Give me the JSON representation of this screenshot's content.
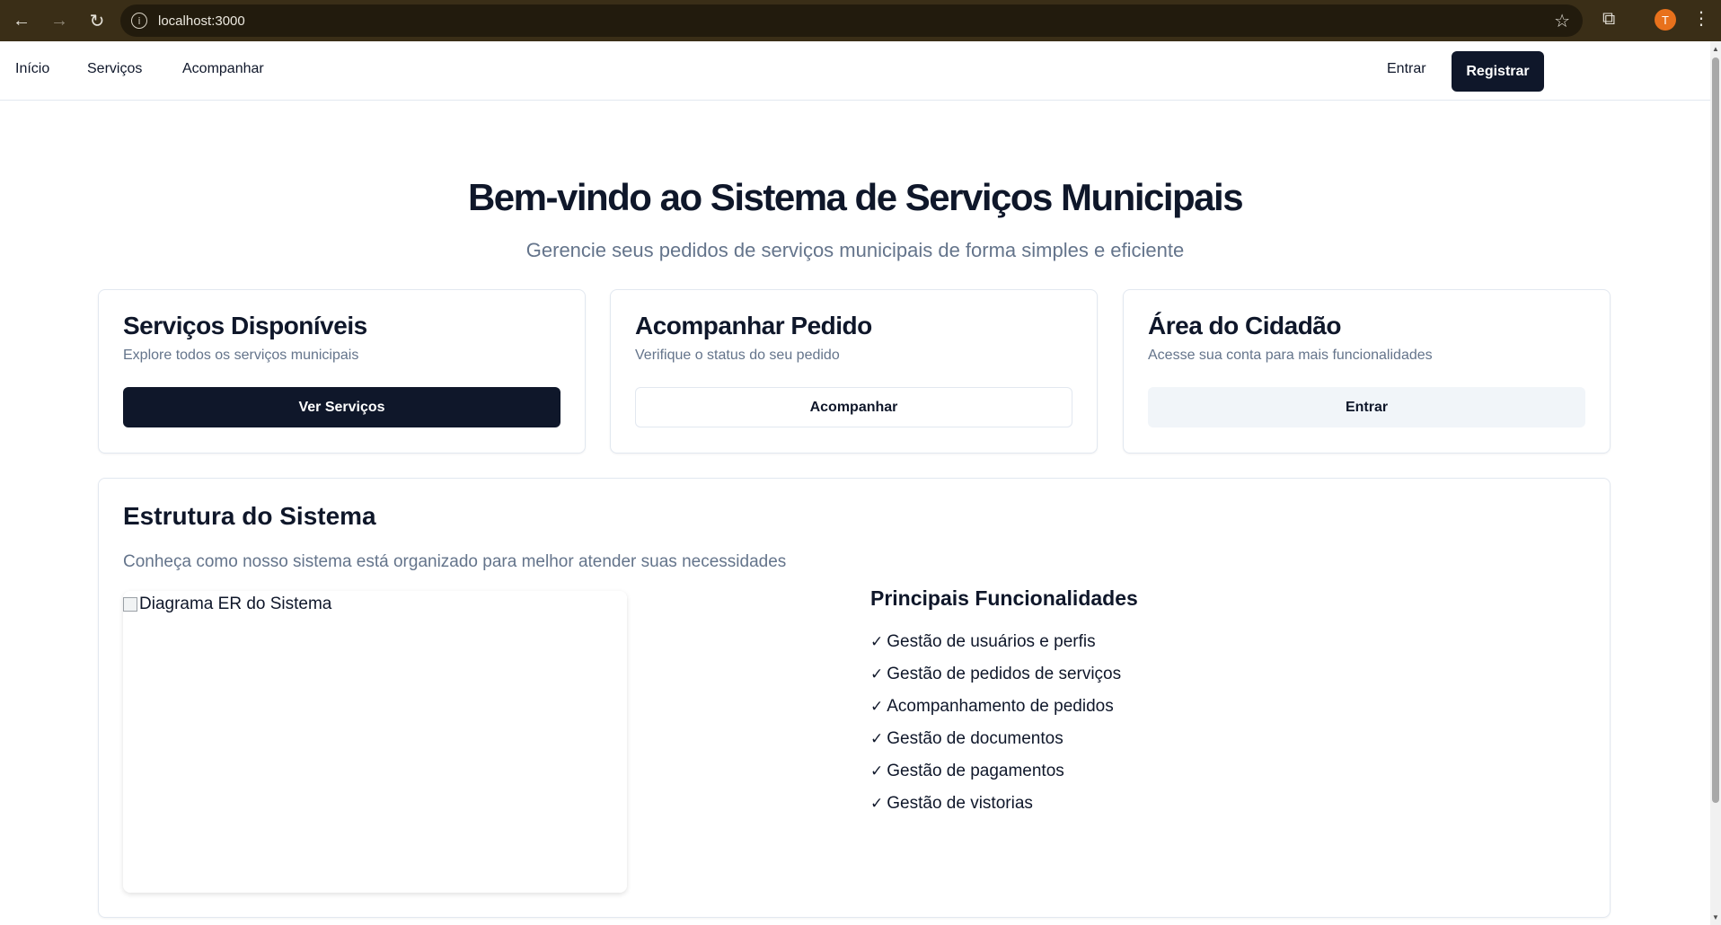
{
  "browser": {
    "url": "localhost:3000",
    "profile_initial": "T"
  },
  "nav": {
    "home": "Início",
    "services": "Serviços",
    "track": "Acompanhar",
    "login": "Entrar",
    "register": "Registrar"
  },
  "hero": {
    "title": "Bem-vindo ao Sistema de Serviços Municipais",
    "subtitle": "Gerencie seus pedidos de serviços municipais de forma simples e eficiente"
  },
  "cards": [
    {
      "title": "Serviços Disponíveis",
      "description": "Explore todos os serviços municipais",
      "button": "Ver Serviços"
    },
    {
      "title": "Acompanhar Pedido",
      "description": "Verifique o status do seu pedido",
      "button": "Acompanhar"
    },
    {
      "title": "Área do Cidadão",
      "description": "Acesse sua conta para mais funcionalidades",
      "button": "Entrar"
    }
  ],
  "system": {
    "title": "Estrutura do Sistema",
    "description": "Conheça como nosso sistema está organizado para melhor atender suas necessidades",
    "diagram_alt": "Diagrama ER do Sistema",
    "features_title": "Principais Funcionalidades",
    "features": [
      "Gestão de usuários e perfis",
      "Gestão de pedidos de serviços",
      "Acompanhamento de pedidos",
      "Gestão de documentos",
      "Gestão de pagamentos",
      "Gestão de vistorias"
    ]
  },
  "colors": {
    "primary": "#0f172a",
    "muted_text": "#64748b",
    "border": "#e2e8f0",
    "chrome": "#3a2e17",
    "profile": "#e8711c"
  }
}
